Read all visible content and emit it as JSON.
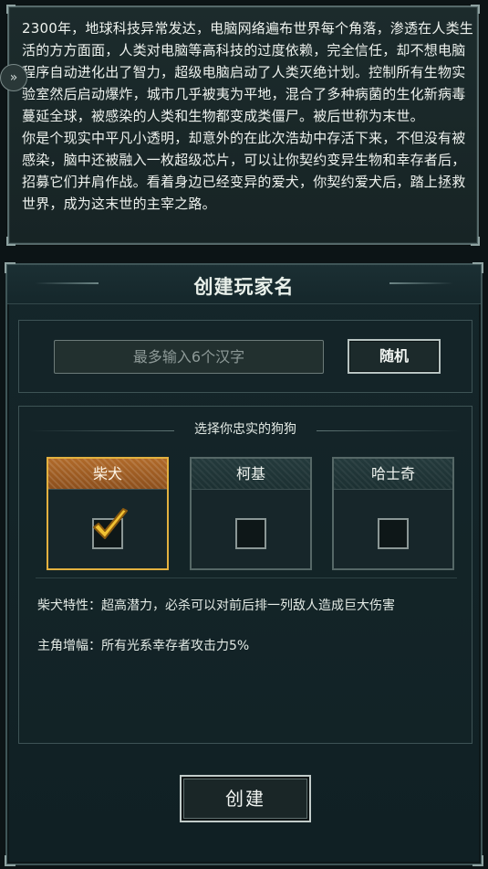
{
  "story": {
    "text": "2300年，地球科技异常发达，电脑网络遍布世界每个角落，渗透在人类生活的方方面面，人类对电脑等高科技的过度依赖，完全信任，却不想电脑程序自动进化出了智力，超级电脑启动了人类灭绝计划。控制所有生物实验室然后启动爆炸，城市几乎被夷为平地，混合了多种病菌的生化新病毒蔓延全球，被感染的人类和生物都变成类僵尸。被后世称为末世。\n你是个现实中平凡小透明，却意外的在此次浩劫中存活下来，不但没有被感染，脑中还被融入一枚超级芯片，可以让你契约变异生物和幸存者后，招募它们并肩作战。看着身边已经变异的爱犬，你契约爱犬后，踏上拯救世界，成为这末世的主宰之路。"
  },
  "dialog": {
    "title": "创建玩家名",
    "name_placeholder": "最多输入6个汉字",
    "name_value": "",
    "random_label": "随机",
    "dog_select_label": "选择你忠实的狗狗",
    "dogs": [
      {
        "label": "柴犬",
        "selected": true
      },
      {
        "label": "柯基",
        "selected": false
      },
      {
        "label": "哈士奇",
        "selected": false
      }
    ],
    "trait_text": "柴犬特性：超高潜力，必杀可以对前后排一列敌人造成巨大伤害",
    "bonus_text": "主角增幅：所有光系幸存者攻击力5%",
    "create_label": "创建"
  },
  "colors": {
    "accent_gold": "#e3b13f",
    "selected_header": "#b06a2a",
    "panel_bg": "#172425"
  },
  "icons": {
    "side_tab": "chevron-double-right-icon",
    "check": "checkmark-icon"
  }
}
